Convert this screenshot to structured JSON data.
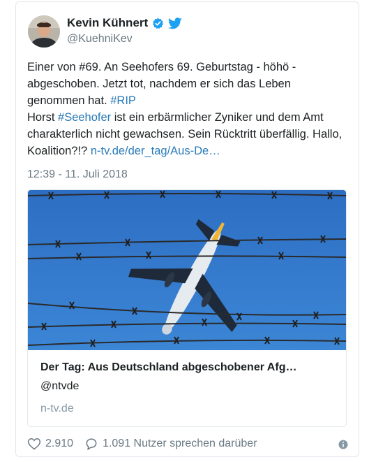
{
  "author": {
    "name": "Kevin Kühnert",
    "handle": "@KuehniKev"
  },
  "tweet": {
    "line1": "Einer von #69. An Seehofers 69. Geburtstag - höhö - abgeschoben. Jetzt tot, nachdem er sich das Leben genommen hat.",
    "hashtag_rip": "#RIP",
    "line2_prefix": "Horst",
    "hashtag_seehofer": "#Seehofer",
    "line2_suffix": "ist ein erbärmlicher Zyniker und dem Amt charakterlich nicht gewachsen. Sein Rücktritt überfällig. Hallo, Koalition?!?",
    "link_text": "n-tv.de/der_tag/Aus-De…",
    "timestamp": "12:39 - 11. Juli 2018"
  },
  "card": {
    "title": "Der Tag: Aus Deutschland abgeschobener Afg…",
    "handle": "@ntvde",
    "domain": "n-tv.de"
  },
  "actions": {
    "likes": "2.910",
    "comments_label": "1.091 Nutzer sprechen darüber"
  },
  "icons": {
    "verified": "verified-badge-icon",
    "bird": "twitter-bird-icon",
    "heart": "heart-icon",
    "comment": "comment-icon",
    "info": "info-icon"
  },
  "colors": {
    "link": "#2b7bb9",
    "verified": "#1da1f2",
    "secondary_text": "#697882",
    "sky": "#2a6fc6"
  }
}
